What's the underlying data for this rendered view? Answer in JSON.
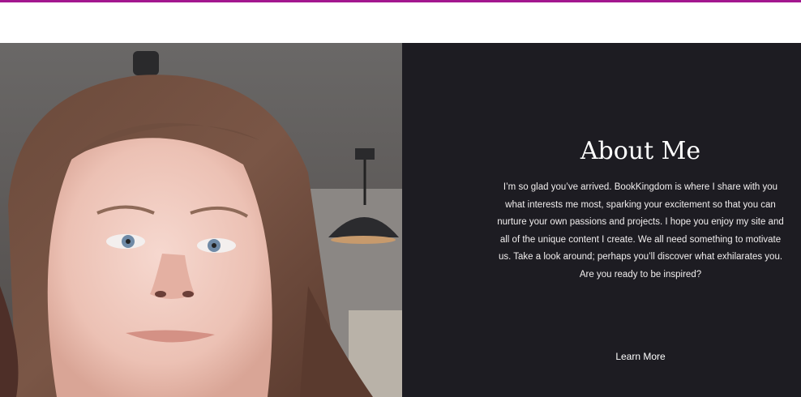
{
  "colors": {
    "accent_line": "#a3178f",
    "about_background": "#1d1c22",
    "text": "#ffffff"
  },
  "photo": {
    "alt": "portrait-photo"
  },
  "about": {
    "title": "About Me",
    "body": "I’m so glad you’ve arrived. BookKingdom is where I share with you what interests me most, sparking your excitement so that you can nurture your own passions and projects. I hope you enjoy my site and all of the unique content I create. We all need something to motivate us. Take a look around; perhaps you’ll discover what exhilarates you. Are you ready to be inspired?",
    "button_label": "Learn More"
  }
}
